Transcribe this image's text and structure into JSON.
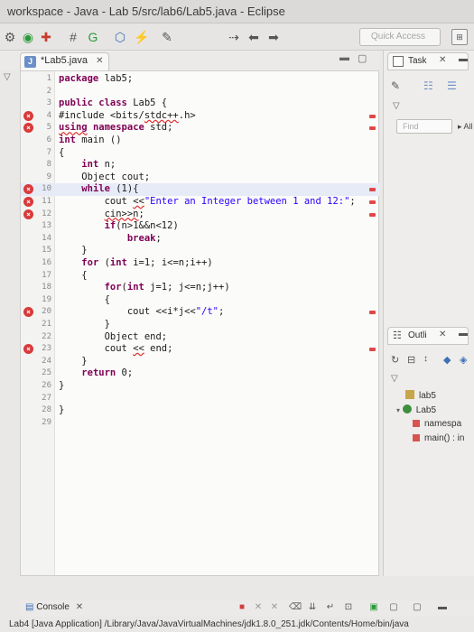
{
  "window": {
    "title": "workspace - Java - Lab 5/src/lab6/Lab5.java - Eclipse"
  },
  "toolbar": {
    "quick_access_placeholder": "Quick Access"
  },
  "editor_tab": {
    "label": "*Lab5.java",
    "close": "✕"
  },
  "code": [
    {
      "n": "1",
      "text": "package lab5;",
      "marker": false,
      "hl": false
    },
    {
      "n": "2",
      "text": "",
      "marker": false,
      "hl": false
    },
    {
      "n": "3",
      "text": "public class Lab5 {",
      "marker": false,
      "hl": false
    },
    {
      "n": "4",
      "text": "#include <bits/stdc++.h>",
      "marker": true,
      "hl": false
    },
    {
      "n": "5",
      "text": "using namespace std;",
      "marker": true,
      "hl": false
    },
    {
      "n": "6",
      "text": "int main ()",
      "marker": false,
      "hl": false
    },
    {
      "n": "7",
      "text": "{",
      "marker": false,
      "hl": false
    },
    {
      "n": "8",
      "text": "    int n;",
      "marker": false,
      "hl": false
    },
    {
      "n": "9",
      "text": "    Object cout;",
      "marker": false,
      "hl": false
    },
    {
      "n": "10",
      "text": "    while (1){",
      "marker": true,
      "hl": true
    },
    {
      "n": "11",
      "text": "        cout <<\"Enter an Integer between 1 and 12:\";",
      "marker": true,
      "hl": false
    },
    {
      "n": "12",
      "text": "        cin>>n;",
      "marker": true,
      "hl": false
    },
    {
      "n": "13",
      "text": "        if(n>1&&n<12)",
      "marker": false,
      "hl": false
    },
    {
      "n": "14",
      "text": "            break;",
      "marker": false,
      "hl": false
    },
    {
      "n": "15",
      "text": "    }",
      "marker": false,
      "hl": false
    },
    {
      "n": "16",
      "text": "    for (int i=1; i<=n;i++)",
      "marker": false,
      "hl": false
    },
    {
      "n": "17",
      "text": "    {",
      "marker": false,
      "hl": false
    },
    {
      "n": "18",
      "text": "        for(int j=1; j<=n;j++)",
      "marker": false,
      "hl": false
    },
    {
      "n": "19",
      "text": "        {",
      "marker": false,
      "hl": false
    },
    {
      "n": "20",
      "text": "            cout <<i*j<<\"/t\";",
      "marker": true,
      "hl": false
    },
    {
      "n": "21",
      "text": "        }",
      "marker": false,
      "hl": false
    },
    {
      "n": "22",
      "text": "        Object end;",
      "marker": false,
      "hl": false
    },
    {
      "n": "23",
      "text": "        cout << end;",
      "marker": true,
      "hl": false
    },
    {
      "n": "24",
      "text": "    }",
      "marker": false,
      "hl": false
    },
    {
      "n": "25",
      "text": "    return 0;",
      "marker": false,
      "hl": false
    },
    {
      "n": "26",
      "text": "}",
      "marker": false,
      "hl": false
    },
    {
      "n": "27",
      "text": "",
      "marker": false,
      "hl": false
    },
    {
      "n": "28",
      "text": "}",
      "marker": false,
      "hl": false
    },
    {
      "n": "29",
      "text": "",
      "marker": false,
      "hl": false
    }
  ],
  "task_panel": {
    "label": "Task",
    "find_placeholder": "Find",
    "all_label": "All"
  },
  "outline_panel": {
    "label": "Outli",
    "items": [
      "lab5",
      "Lab5",
      "namespa",
      "main() : in"
    ]
  },
  "console": {
    "label": "Console",
    "info": "Lab4 [Java Application] /Library/Java/JavaVirtualMachines/jdk1.8.0_251.jdk/Contents/Home/bin/java"
  }
}
